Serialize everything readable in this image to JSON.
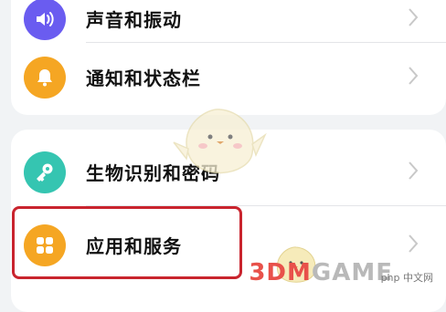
{
  "settings": {
    "items": [
      {
        "label": "声音和振动",
        "icon": "speaker-icon",
        "color": "#6a5cf0"
      },
      {
        "label": "通知和状态栏",
        "icon": "bell-icon",
        "color": "#f5a623"
      },
      {
        "label": "生物识别和密码",
        "icon": "key-icon",
        "color": "#35c5b1"
      },
      {
        "label": "应用和服务",
        "icon": "apps-grid-icon",
        "color": "#f5a623"
      }
    ]
  },
  "highlight_color": "#c9242e",
  "watermark": {
    "brand_part1": "3DM",
    "brand_part2": "GAME",
    "site": "php 中文网"
  }
}
